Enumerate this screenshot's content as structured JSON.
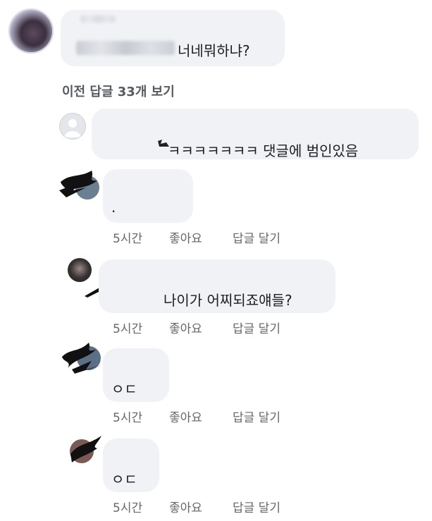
{
  "top_comment": {
    "text": "너네뭐하냐?"
  },
  "view_previous": "이전 답글 33개 보기",
  "replies": [
    {
      "text": "ㅋㅋㅋㅋㅋㅋㅋ 댓글에 범인있음",
      "time": "",
      "like": "",
      "reply": ""
    },
    {
      "text": ".",
      "time": "5시간",
      "like": "좋아요",
      "reply": "답글 달기"
    },
    {
      "text": "나이가 어찌되죠얘들?",
      "time": "5시간",
      "like": "좋아요",
      "reply": "답글 달기"
    },
    {
      "text": "ㅇㄷ",
      "time": "5시간",
      "like": "좋아요",
      "reply": "답글 달기"
    },
    {
      "text": "ㅇㄷ",
      "time": "5시간",
      "like": "좋아요",
      "reply": "답글 달기"
    }
  ],
  "colors": {
    "bubble": "#f0f2f5",
    "action_text": "#65676b",
    "text": "#1c1e21"
  },
  "icons": {
    "default_avatar": "person-silhouette-icon"
  }
}
